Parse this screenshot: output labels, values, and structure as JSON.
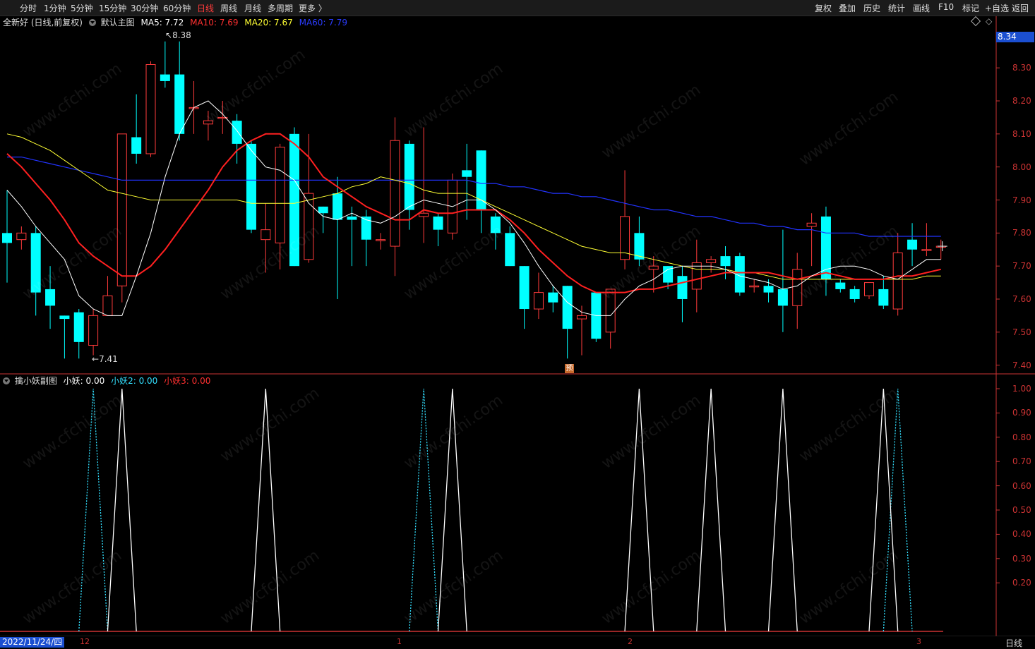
{
  "toolbar": {
    "left_items": [
      "分时",
      "1分钟",
      "5分钟",
      "15分钟",
      "30分钟",
      "60分钟",
      "日线",
      "周线",
      "月线",
      "多周期",
      "更多 〉"
    ],
    "active_item": "日线",
    "right_items": [
      "复权",
      "叠加",
      "历史",
      "统计",
      "画线",
      "F10",
      "标记",
      "+自选",
      "返回"
    ]
  },
  "main_legend": {
    "title": "全新好 (日线,前复权)",
    "indicator": "默认主图",
    "ma5": "MA5: 7.72",
    "ma10": "MA10: 7.69",
    "ma20": "MA20: 7.67",
    "ma60": "MA60: 7.79"
  },
  "sub_legend": {
    "indicator": "擒小妖副图",
    "v1": "小妖: 0.00",
    "v2": "小妖2: 0.00",
    "v3": "小妖3: 0.00"
  },
  "price_badge": "8.34",
  "high_label": "8.38",
  "low_label": "7.41",
  "pre_badge": "预",
  "date_label": "2022/11/24/四",
  "months": [
    "12",
    "1",
    "2",
    "3"
  ],
  "period_label": "日线",
  "watermark": "www.cfchi.com",
  "colors": {
    "up": "#ff3b3b",
    "down": "#00ffff",
    "ma5": "#ffffff",
    "ma10": "#ff2020",
    "ma20": "#ffff33",
    "ma60": "#2233ff",
    "axis": "#cc3333"
  },
  "chart_data": {
    "type": "candlestick",
    "y_axis_main": [
      "8.30",
      "8.20",
      "8.10",
      "8.00",
      "7.90",
      "7.80",
      "7.70",
      "7.60",
      "7.50",
      "7.40"
    ],
    "y_axis_sub": [
      "1.00",
      "0.90",
      "0.80",
      "0.70",
      "0.60",
      "0.50",
      "0.40",
      "0.30",
      "0.20"
    ],
    "ylim_main": [
      7.38,
      8.42
    ],
    "ylim_sub": [
      0,
      1.0
    ],
    "candles": [
      [
        7.8,
        7.77,
        7.93,
        7.65
      ],
      [
        7.78,
        7.8,
        7.82,
        7.75
      ],
      [
        7.8,
        7.62,
        7.82,
        7.55
      ],
      [
        7.63,
        7.58,
        7.7,
        7.51
      ],
      [
        7.55,
        7.54,
        7.55,
        7.42
      ],
      [
        7.56,
        7.47,
        7.57,
        7.42
      ],
      [
        7.46,
        7.55,
        7.57,
        7.43
      ],
      [
        7.55,
        7.61,
        7.67,
        7.55
      ],
      [
        7.64,
        8.1,
        8.1,
        7.59
      ],
      [
        8.09,
        8.04,
        8.22,
        8.01
      ],
      [
        8.04,
        8.31,
        8.32,
        8.03
      ],
      [
        8.28,
        8.26,
        8.38,
        8.24
      ],
      [
        8.28,
        8.1,
        8.38,
        8.08
      ],
      [
        8.18,
        8.18,
        8.26,
        8.1
      ],
      [
        8.13,
        8.14,
        8.17,
        8.08
      ],
      [
        8.15,
        8.15,
        8.2,
        8.1
      ],
      [
        8.14,
        8.07,
        8.16,
        8.01
      ],
      [
        8.07,
        7.81,
        8.08,
        7.8
      ],
      [
        7.78,
        7.81,
        7.89,
        7.68
      ],
      [
        7.77,
        8.06,
        8.07,
        7.69
      ],
      [
        8.1,
        7.7,
        8.12,
        7.7
      ],
      [
        7.72,
        7.92,
        8.1,
        7.71
      ],
      [
        7.88,
        7.86,
        7.88,
        7.8
      ],
      [
        7.92,
        7.84,
        7.97,
        7.6
      ],
      [
        7.85,
        7.84,
        7.88,
        7.7
      ],
      [
        7.85,
        7.78,
        7.87,
        7.7
      ],
      [
        7.78,
        7.78,
        7.8,
        7.75
      ],
      [
        7.76,
        8.08,
        8.15,
        7.67
      ],
      [
        8.07,
        7.87,
        8.08,
        7.81
      ],
      [
        7.85,
        7.86,
        8.12,
        7.77
      ],
      [
        7.85,
        7.81,
        7.86,
        7.76
      ],
      [
        7.8,
        7.96,
        7.98,
        7.78
      ],
      [
        7.99,
        7.97,
        8.07,
        7.84
      ],
      [
        8.05,
        7.87,
        8.05,
        7.8
      ],
      [
        7.85,
        7.8,
        7.86,
        7.75
      ],
      [
        7.8,
        7.7,
        7.82,
        7.7
      ],
      [
        7.7,
        7.57,
        7.7,
        7.51
      ],
      [
        7.57,
        7.62,
        7.68,
        7.54
      ],
      [
        7.62,
        7.59,
        7.64,
        7.56
      ],
      [
        7.64,
        7.51,
        7.64,
        7.42
      ],
      [
        7.54,
        7.55,
        7.58,
        7.43
      ],
      [
        7.62,
        7.48,
        7.62,
        7.47
      ],
      [
        7.5,
        7.63,
        7.63,
        7.45
      ],
      [
        7.72,
        7.85,
        7.99,
        7.69
      ],
      [
        7.8,
        7.72,
        7.85,
        7.7
      ],
      [
        7.69,
        7.7,
        7.73,
        7.62
      ],
      [
        7.7,
        7.65,
        7.7,
        7.63
      ],
      [
        7.67,
        7.6,
        7.7,
        7.53
      ],
      [
        7.63,
        7.71,
        7.78,
        7.56
      ],
      [
        7.71,
        7.72,
        7.73,
        7.68
      ],
      [
        7.73,
        7.7,
        7.76,
        7.66
      ],
      [
        7.73,
        7.62,
        7.74,
        7.61
      ],
      [
        7.64,
        7.64,
        7.66,
        7.62
      ],
      [
        7.64,
        7.62,
        7.66,
        7.59
      ],
      [
        7.63,
        7.58,
        7.81,
        7.5
      ],
      [
        7.58,
        7.69,
        7.74,
        7.51
      ],
      [
        7.82,
        7.83,
        7.86,
        7.7
      ],
      [
        7.85,
        7.66,
        7.88,
        7.61
      ],
      [
        7.65,
        7.63,
        7.66,
        7.62
      ],
      [
        7.63,
        7.6,
        7.64,
        7.59
      ],
      [
        7.61,
        7.65,
        7.65,
        7.6
      ],
      [
        7.63,
        7.58,
        7.67,
        7.57
      ],
      [
        7.57,
        7.74,
        7.8,
        7.55
      ],
      [
        7.78,
        7.75,
        7.83,
        7.7
      ],
      [
        7.75,
        7.75,
        7.83,
        7.73
      ],
      [
        7.76,
        7.76,
        7.78,
        7.72
      ]
    ],
    "ma5": [
      7.93,
      7.88,
      7.82,
      7.77,
      7.72,
      7.61,
      7.57,
      7.55,
      7.55,
      7.67,
      7.8,
      7.97,
      8.1,
      8.18,
      8.2,
      8.16,
      8.11,
      8.05,
      8.0,
      7.99,
      7.96,
      7.89,
      7.85,
      7.84,
      7.86,
      7.84,
      7.83,
      7.85,
      7.88,
      7.9,
      7.89,
      7.88,
      7.9,
      7.9,
      7.87,
      7.83,
      7.77,
      7.7,
      7.64,
      7.59,
      7.56,
      7.55,
      7.55,
      7.6,
      7.64,
      7.66,
      7.69,
      7.7,
      7.7,
      7.7,
      7.69,
      7.67,
      7.66,
      7.65,
      7.63,
      7.64,
      7.67,
      7.69,
      7.7,
      7.7,
      7.69,
      7.67,
      7.66,
      7.69,
      7.72,
      7.72
    ],
    "ma10": [
      8.04,
      8.0,
      7.95,
      7.9,
      7.84,
      7.77,
      7.73,
      7.7,
      7.67,
      7.67,
      7.7,
      7.75,
      7.81,
      7.87,
      7.93,
      8.0,
      8.05,
      8.08,
      8.1,
      8.1,
      8.07,
      8.03,
      7.97,
      7.94,
      7.91,
      7.88,
      7.86,
      7.84,
      7.84,
      7.87,
      7.86,
      7.86,
      7.87,
      7.87,
      7.87,
      7.84,
      7.8,
      7.75,
      7.71,
      7.67,
      7.64,
      7.62,
      7.62,
      7.62,
      7.63,
      7.63,
      7.64,
      7.65,
      7.66,
      7.67,
      7.68,
      7.68,
      7.68,
      7.68,
      7.67,
      7.66,
      7.67,
      7.68,
      7.67,
      7.66,
      7.66,
      7.66,
      7.67,
      7.67,
      7.68,
      7.69
    ],
    "ma20": [
      8.1,
      8.09,
      8.07,
      8.05,
      8.02,
      7.99,
      7.96,
      7.93,
      7.92,
      7.91,
      7.9,
      7.9,
      7.9,
      7.9,
      7.9,
      7.9,
      7.9,
      7.89,
      7.89,
      7.89,
      7.89,
      7.9,
      7.91,
      7.92,
      7.94,
      7.95,
      7.97,
      7.96,
      7.95,
      7.93,
      7.92,
      7.92,
      7.92,
      7.9,
      7.88,
      7.86,
      7.84,
      7.82,
      7.8,
      7.78,
      7.76,
      7.75,
      7.74,
      7.74,
      7.73,
      7.72,
      7.71,
      7.7,
      7.69,
      7.69,
      7.69,
      7.68,
      7.68,
      7.67,
      7.66,
      7.66,
      7.66,
      7.66,
      7.66,
      7.66,
      7.66,
      7.66,
      7.66,
      7.66,
      7.67,
      7.67
    ],
    "ma60": [
      8.03,
      8.03,
      8.02,
      8.01,
      8.0,
      7.99,
      7.98,
      7.97,
      7.96,
      7.96,
      7.96,
      7.96,
      7.96,
      7.96,
      7.96,
      7.96,
      7.96,
      7.96,
      7.96,
      7.96,
      7.96,
      7.96,
      7.96,
      7.96,
      7.96,
      7.96,
      7.96,
      7.96,
      7.96,
      7.96,
      7.96,
      7.96,
      7.96,
      7.95,
      7.95,
      7.94,
      7.94,
      7.93,
      7.92,
      7.92,
      7.91,
      7.91,
      7.9,
      7.89,
      7.88,
      7.87,
      7.87,
      7.86,
      7.85,
      7.85,
      7.84,
      7.83,
      7.83,
      7.82,
      7.82,
      7.81,
      7.81,
      7.8,
      7.8,
      7.8,
      7.79,
      7.79,
      7.79,
      7.79,
      7.79,
      7.79
    ],
    "sub_white_peaks": [
      8,
      18,
      31,
      44,
      49,
      54,
      61
    ],
    "sub_cyan_peaks": [
      6,
      29,
      62
    ]
  }
}
